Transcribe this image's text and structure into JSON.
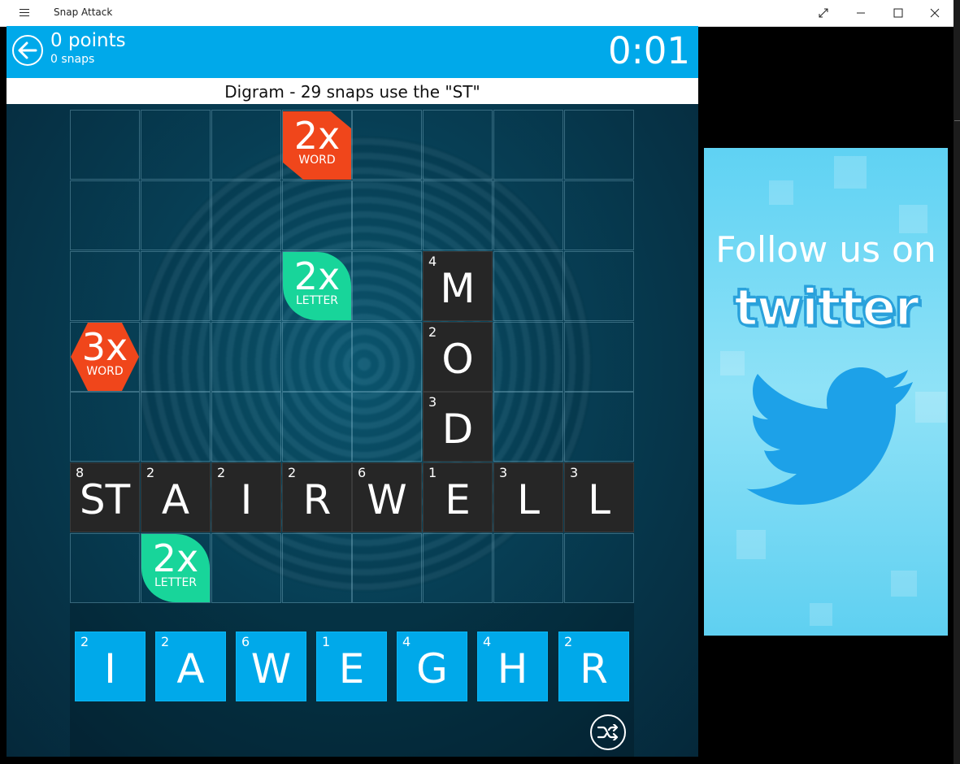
{
  "window": {
    "title": "Snap Attack"
  },
  "header": {
    "points": "0 points",
    "snaps": "0 snaps",
    "timer": "0:01"
  },
  "hint": "Digram - 29 snaps use the \"ST\"",
  "board": {
    "bonuses": [
      {
        "big": "2x",
        "small": "WORD",
        "kind": "word"
      },
      {
        "big": "2x",
        "small": "LETTER",
        "kind": "letter"
      },
      {
        "big": "3x",
        "small": "WORD",
        "kind": "word3"
      },
      {
        "big": "2x",
        "small": "LETTER",
        "kind": "letter"
      }
    ],
    "vertical_word": [
      {
        "num": "4",
        "letter": "M"
      },
      {
        "num": "2",
        "letter": "O"
      },
      {
        "num": "3",
        "letter": "D"
      }
    ],
    "horizontal_word": [
      {
        "num": "8",
        "letter": "ST"
      },
      {
        "num": "2",
        "letter": "A"
      },
      {
        "num": "2",
        "letter": "I"
      },
      {
        "num": "2",
        "letter": "R"
      },
      {
        "num": "6",
        "letter": "W"
      },
      {
        "num": "1",
        "letter": "E"
      },
      {
        "num": "3",
        "letter": "L"
      },
      {
        "num": "3",
        "letter": "L"
      }
    ]
  },
  "rack": [
    {
      "num": "2",
      "letter": "I"
    },
    {
      "num": "2",
      "letter": "A"
    },
    {
      "num": "6",
      "letter": "W"
    },
    {
      "num": "1",
      "letter": "E"
    },
    {
      "num": "4",
      "letter": "G"
    },
    {
      "num": "4",
      "letter": "H"
    },
    {
      "num": "2",
      "letter": "R"
    }
  ],
  "ad": {
    "line1": "Follow us on",
    "line2": "twitter"
  },
  "colors": {
    "accent": "#00a9ea",
    "word_bonus": "#f0461b",
    "letter_bonus": "#18d59a",
    "tile": "#262626"
  },
  "icons": [
    "hamburger-icon",
    "restore-icon",
    "minimize-icon",
    "maximize-icon",
    "close-icon",
    "back-arrow-icon",
    "shuffle-icon",
    "twitter-bird-icon"
  ]
}
